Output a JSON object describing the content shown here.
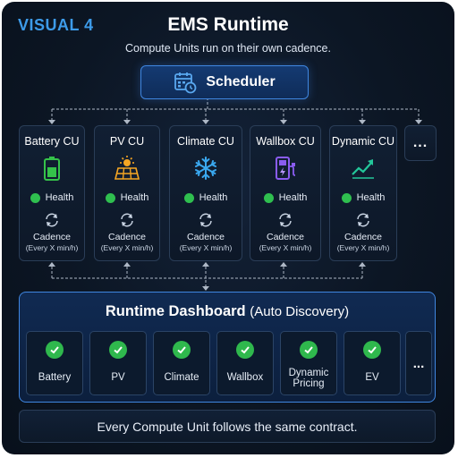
{
  "visual_label": "VISUAL 4",
  "title": "EMS Runtime",
  "subtitle": "Compute Units run on their own cadence.",
  "scheduler": {
    "label": "Scheduler",
    "icon": "calendar-clock-icon"
  },
  "compute_units": [
    {
      "name": "Battery CU",
      "icon": "battery-icon",
      "health_label": "Health",
      "cadence_label": "Cadence",
      "cadence_sub": "(Every X min/h)"
    },
    {
      "name": "PV CU",
      "icon": "solar-panel-icon",
      "health_label": "Health",
      "cadence_label": "Cadence",
      "cadence_sub": "(Every X min/h)"
    },
    {
      "name": "Climate CU",
      "icon": "snowflake-icon",
      "health_label": "Health",
      "cadence_label": "Cadence",
      "cadence_sub": "(Every X min/h)"
    },
    {
      "name": "Wallbox CU",
      "icon": "ev-charger-icon",
      "health_label": "Health",
      "cadence_label": "Cadence",
      "cadence_sub": "(Every X min/h)"
    },
    {
      "name": "Dynamic CU",
      "icon": "trend-chart-icon",
      "health_label": "Health",
      "cadence_label": "Cadence",
      "cadence_sub": "(Every X min/h)"
    }
  ],
  "more_label": "...",
  "dashboard": {
    "title_bold": "Runtime Dashboard",
    "title_light": "(Auto Discovery)",
    "tiles": [
      {
        "line1": "Battery",
        "line2": ""
      },
      {
        "line1": "PV",
        "line2": ""
      },
      {
        "line1": "Climate",
        "line2": ""
      },
      {
        "line1": "Wallbox",
        "line2": ""
      },
      {
        "line1": "Dynamic",
        "line2": "Pricing"
      },
      {
        "line1": "EV",
        "line2": ""
      }
    ],
    "more_label": "..."
  },
  "footer": "Every Compute Unit follows the same contract.",
  "colors": {
    "accent_blue": "#3d9be9",
    "health_green": "#2fbf4f",
    "battery_green": "#35c24a",
    "solar_orange": "#f5a623",
    "climate_blue": "#3aa8f0",
    "wallbox_purple": "#8a5cf0",
    "trend_green": "#23c79a"
  }
}
